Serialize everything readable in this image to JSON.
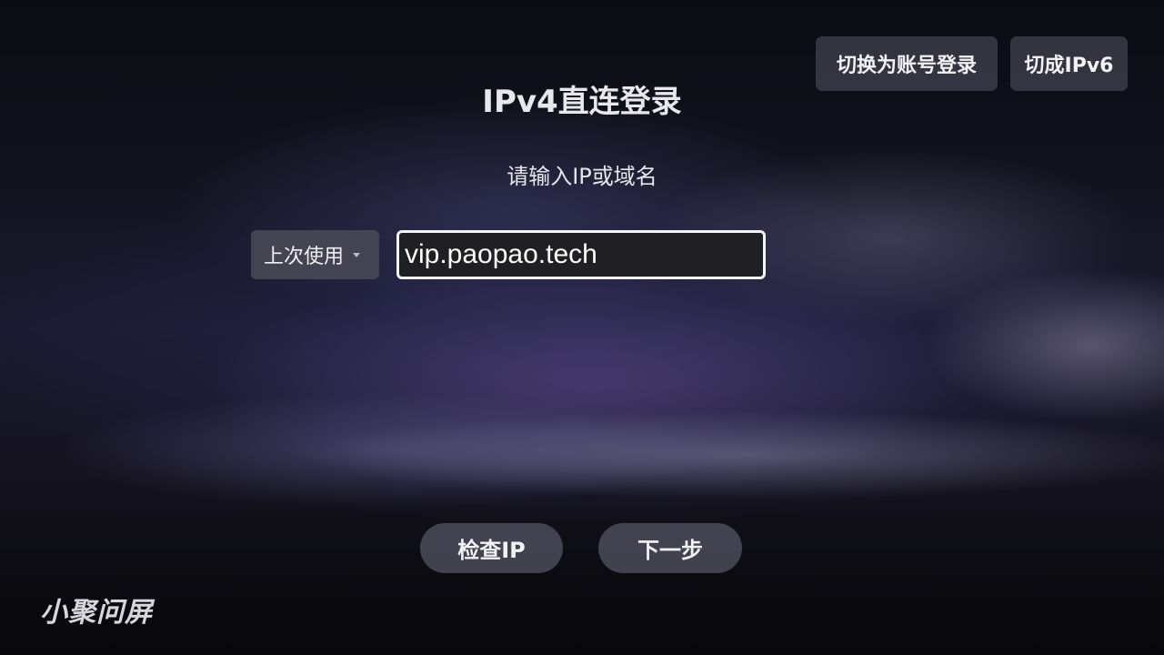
{
  "header": {
    "switch_account_label": "切换为账号登录",
    "switch_ipv6_label": "切成IPv6"
  },
  "title": "IPv4直连登录",
  "subtitle": "请输入IP或域名",
  "form": {
    "history_label": "上次使用",
    "ip_value": "vip.paopao.tech"
  },
  "actions": {
    "check_ip_label": "检查IP",
    "next_label": "下一步"
  },
  "brand": "小聚问屏",
  "colors": {
    "button_bg": "#3a3a48",
    "input_bg": "#202024",
    "input_border": "#f4f4f6",
    "text": "#f2f2f4"
  },
  "icons": {
    "history_dropdown": "caret-down-icon"
  }
}
